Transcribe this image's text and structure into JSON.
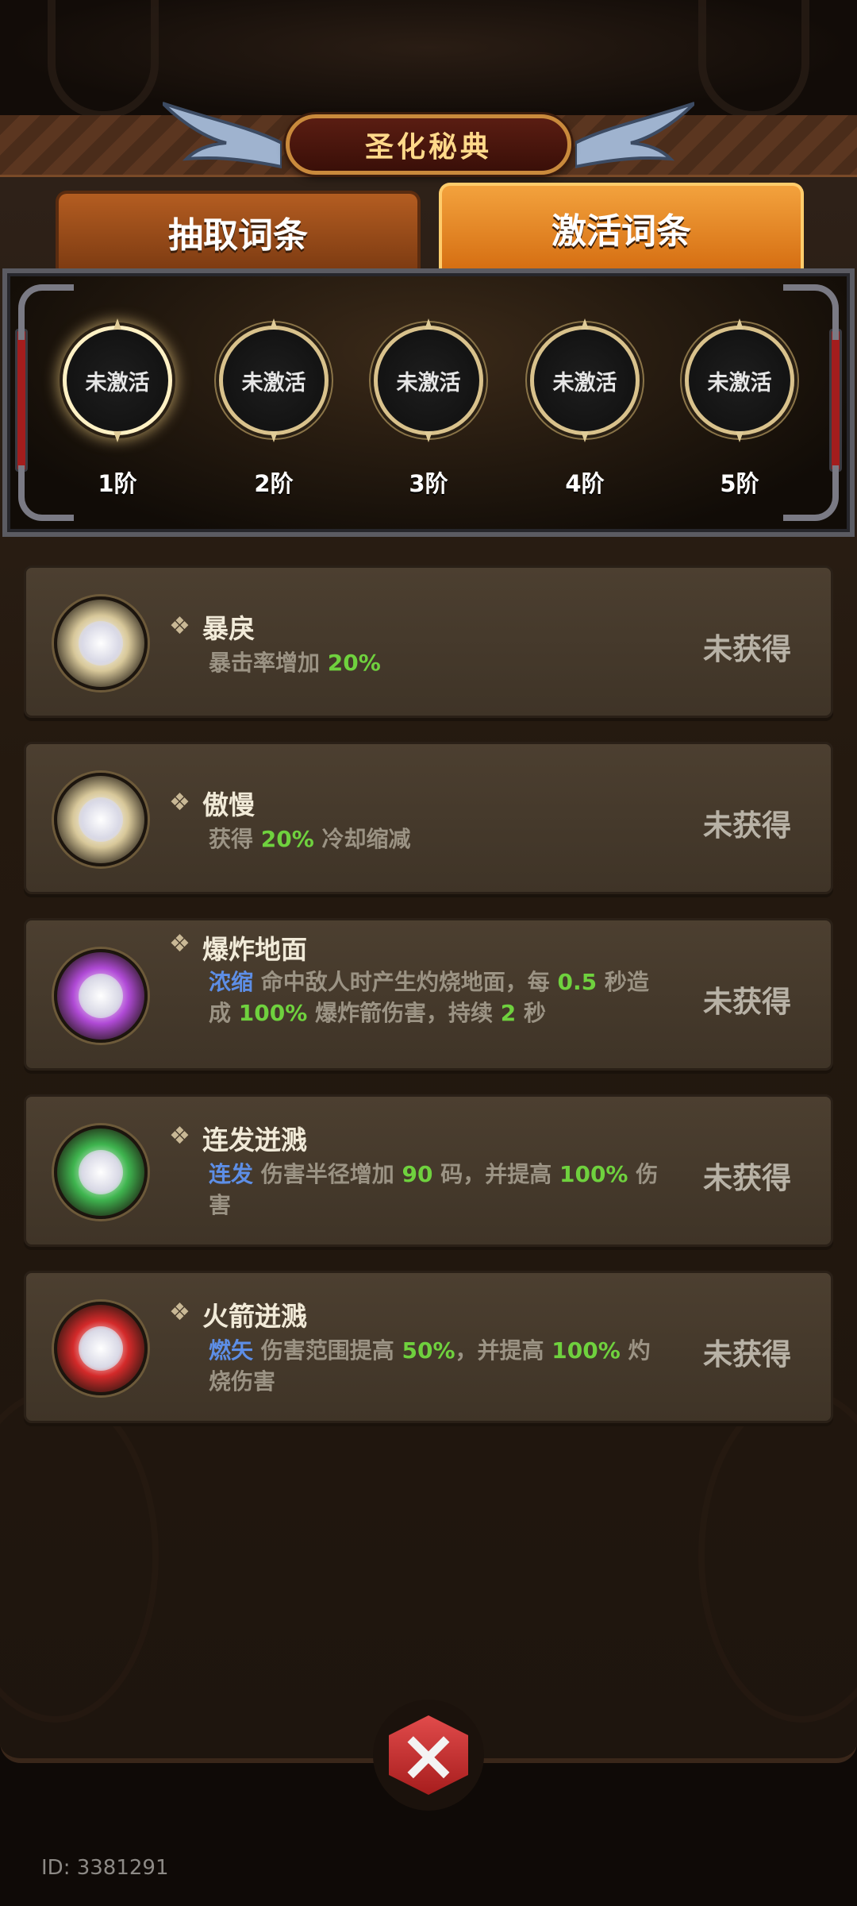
{
  "header": {
    "title": "圣化秘典"
  },
  "tabs": [
    {
      "label": "抽取词条",
      "selected": false
    },
    {
      "label": "激活词条",
      "selected": true
    }
  ],
  "stages": [
    {
      "status": "未激活",
      "tier": "1阶",
      "highlighted": true
    },
    {
      "status": "未激活",
      "tier": "2阶",
      "highlighted": false
    },
    {
      "status": "未激活",
      "tier": "3阶",
      "highlighted": false
    },
    {
      "status": "未激活",
      "tier": "4阶",
      "highlighted": false
    },
    {
      "status": "未激活",
      "tier": "5阶",
      "highlighted": false
    }
  ],
  "entries": [
    {
      "name": "暴戾",
      "orb_color": "#d8c89a",
      "desc": [
        {
          "t": "暴击率增加 ",
          "c": ""
        },
        {
          "t": "20%",
          "c": "g"
        }
      ],
      "status": "未获得"
    },
    {
      "name": "傲慢",
      "orb_color": "#d8c89a",
      "desc": [
        {
          "t": "获得 ",
          "c": ""
        },
        {
          "t": "20%",
          "c": "g"
        },
        {
          "t": " 冷却缩减",
          "c": ""
        }
      ],
      "status": "未获得"
    },
    {
      "name": "爆炸地面",
      "orb_color": "#b04ad6",
      "desc": [
        {
          "t": "浓缩",
          "c": "b"
        },
        {
          "t": " 命中敌人时产生灼烧地面，每 ",
          "c": ""
        },
        {
          "t": "0.5",
          "c": "g"
        },
        {
          "t": " 秒造成 ",
          "c": ""
        },
        {
          "t": "100%",
          "c": "g"
        },
        {
          "t": " 爆炸箭伤害，持续 ",
          "c": ""
        },
        {
          "t": "2",
          "c": "g"
        },
        {
          "t": " 秒",
          "c": ""
        }
      ],
      "status": "未获得"
    },
    {
      "name": "连发迸溅",
      "orb_color": "#3fb54f",
      "desc": [
        {
          "t": "连发",
          "c": "b"
        },
        {
          "t": " 伤害半径增加 ",
          "c": ""
        },
        {
          "t": "90",
          "c": "g"
        },
        {
          "t": " 码，并提高 ",
          "c": ""
        },
        {
          "t": "100%",
          "c": "g"
        },
        {
          "t": " 伤害",
          "c": ""
        }
      ],
      "status": "未获得"
    },
    {
      "name": "火箭迸溅",
      "orb_color": "#d42a2a",
      "desc": [
        {
          "t": "燃矢",
          "c": "b"
        },
        {
          "t": " 伤害范围提高 ",
          "c": ""
        },
        {
          "t": "50%",
          "c": "g"
        },
        {
          "t": "，并提高 ",
          "c": ""
        },
        {
          "t": "100%",
          "c": "g"
        },
        {
          "t": " 灼烧伤害",
          "c": ""
        }
      ],
      "status": "未获得"
    }
  ],
  "footer": {
    "user_id": "ID: 3381291"
  },
  "colors": {
    "accent_orange": "#e8861f",
    "value_green": "#6fd13e",
    "keyword_blue": "#5d8ee6",
    "title_gold": "#ffd98a"
  }
}
